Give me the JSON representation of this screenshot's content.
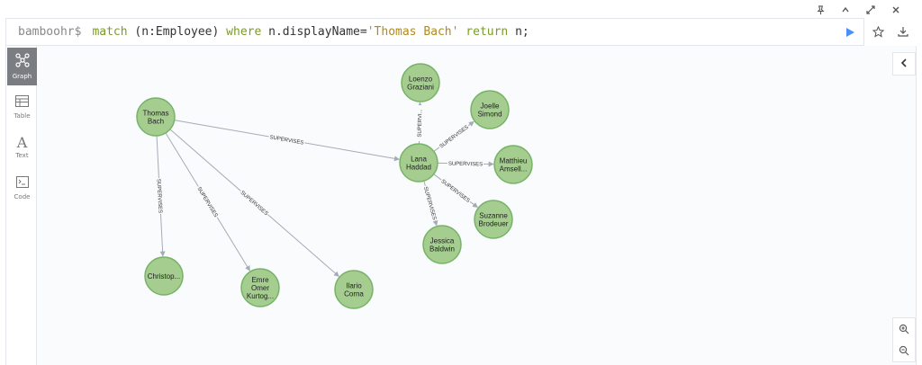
{
  "window": {
    "controls": [
      "pin-icon",
      "collapse-up-icon",
      "expand-icon",
      "close-icon"
    ]
  },
  "query": {
    "prompt": "bamboohr$",
    "parts": [
      {
        "t": "kw",
        "v": "match"
      },
      {
        "t": "txt",
        "v": " (n:Employee) "
      },
      {
        "t": "kw",
        "v": "where"
      },
      {
        "t": "txt",
        "v": " n.displayName="
      },
      {
        "t": "str",
        "v": "'Thomas Bach'"
      },
      {
        "t": "txt",
        "v": " "
      },
      {
        "t": "kw",
        "v": "return"
      },
      {
        "t": "txt",
        "v": " n;"
      }
    ],
    "run_color": "#4a8ef7"
  },
  "views": [
    {
      "label": "Graph",
      "icon": "graph-icon",
      "active": true
    },
    {
      "label": "Table",
      "icon": "table-icon",
      "active": false
    },
    {
      "label": "Text",
      "icon": "text-icon",
      "active": false
    },
    {
      "label": "Code",
      "icon": "code-icon",
      "active": false
    }
  ],
  "graph": {
    "nodes": [
      {
        "id": "thomas",
        "lines": [
          "Thomas",
          "Bach"
        ]
      },
      {
        "id": "lana",
        "lines": [
          "Lana",
          "Haddad"
        ]
      },
      {
        "id": "loenzo",
        "lines": [
          "Loenzo",
          "Graziani"
        ]
      },
      {
        "id": "joelle",
        "lines": [
          "Joelle",
          "Simond"
        ]
      },
      {
        "id": "matthieu",
        "lines": [
          "Matthieu",
          "Amsell..."
        ]
      },
      {
        "id": "suzanne",
        "lines": [
          "Suzanne",
          "Brodeuer"
        ]
      },
      {
        "id": "jessica",
        "lines": [
          "Jessica",
          "Baldwin"
        ]
      },
      {
        "id": "christop",
        "lines": [
          "Christop..."
        ]
      },
      {
        "id": "emre",
        "lines": [
          "Emre",
          "Omer",
          "Kurtog..."
        ]
      },
      {
        "id": "ilario",
        "lines": [
          "Ilario",
          "Corna"
        ]
      }
    ],
    "edges": [
      {
        "from": "thomas",
        "to": "lana",
        "label": "SUPERVISES"
      },
      {
        "from": "thomas",
        "to": "christop",
        "label": "SUPERVISES"
      },
      {
        "from": "thomas",
        "to": "emre",
        "label": "SUPERVISES"
      },
      {
        "from": "thomas",
        "to": "ilario",
        "label": "SUPERVISES"
      },
      {
        "from": "lana",
        "to": "loenzo",
        "label": "SUPERVI..."
      },
      {
        "from": "lana",
        "to": "joelle",
        "label": "SUPERVISES"
      },
      {
        "from": "lana",
        "to": "matthieu",
        "label": "SUPERVISES"
      },
      {
        "from": "lana",
        "to": "suzanne",
        "label": "SUPERVISES"
      },
      {
        "from": "lana",
        "to": "jessica",
        "label": "SUPERVISES"
      }
    ]
  }
}
